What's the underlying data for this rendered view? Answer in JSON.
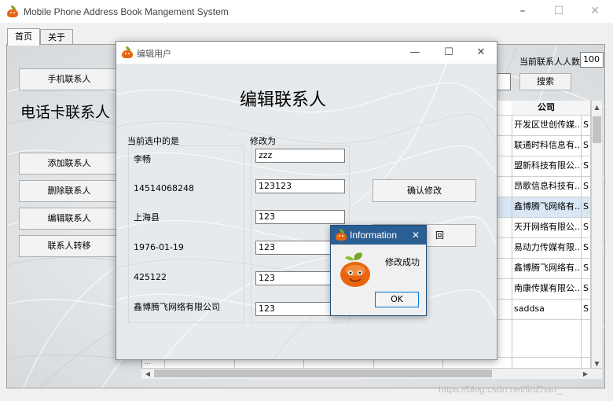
{
  "main_window": {
    "title": "Mobile Phone Address Book Mangement System",
    "controls": {
      "minimize": "–",
      "maximize": "☐",
      "close": "✕"
    },
    "tabs": [
      {
        "label": "首页"
      },
      {
        "label": "关于"
      }
    ],
    "phone_contacts_button": "手机联系人",
    "sim_contacts_heading": "电话卡联系人",
    "contact_count_label": "当前联系人人数",
    "contact_count_value": "100",
    "search_value": "",
    "search_button": "搜索",
    "actions": {
      "add": "添加联系人",
      "delete": "删除联系人",
      "edit": "编辑联系人",
      "transfer": "联系人转移"
    },
    "table": {
      "company_header": "公司",
      "col_next_header": "",
      "rows": [
        {
          "company": "开发区世创传媒...",
          "next": "S"
        },
        {
          "company": "联通时科信息有...",
          "next": "S"
        },
        {
          "company": "盟新科技有限公...",
          "next": "S"
        },
        {
          "company": "昂歌信息科技有...",
          "next": "S"
        },
        {
          "company": "鑫博腾飞网络有...",
          "next": "S"
        },
        {
          "company": "天开网络有限公...",
          "next": "S"
        },
        {
          "company": "易动力传媒有限...",
          "next": "S"
        },
        {
          "company": "鑫博腾飞网络有...",
          "next": "S"
        },
        {
          "company": "南康传媒有限公...",
          "next": "S"
        },
        {
          "company": "saddsa",
          "next": "S"
        }
      ],
      "partial_row_text": "...",
      "selected_row_index": 4
    },
    "scroll": {
      "up": "▲",
      "down": "▼",
      "left": "◀",
      "right": "▶"
    }
  },
  "edit_dialog": {
    "title": "编辑用户",
    "controls": {
      "minimize": "—",
      "maximize": "☐",
      "close": "✕"
    },
    "heading": "编辑联系人",
    "current_label": "当前选中的是",
    "modify_label": "修改为",
    "current_values": [
      "李畅",
      "14514068248",
      "上海县",
      "1976-01-19",
      "425122",
      "鑫博腾飞网络有限公司"
    ],
    "new_values": [
      "zzz",
      "123123",
      "123",
      "123",
      "123",
      "123"
    ],
    "confirm_button": "确认修改",
    "back_button": "返回",
    "back_button_visible": "回"
  },
  "info_popup": {
    "title": "Information",
    "close": "✕",
    "message": "修改成功",
    "ok_button": "OK"
  },
  "watermark": "https://blog.csdn.net/linZhan_",
  "colors": {
    "accent_titlebar": "#2b5f94",
    "icon_orange": "#e8640e",
    "icon_leaf": "#7aa52a",
    "selected_row": "#d9e7f5"
  }
}
